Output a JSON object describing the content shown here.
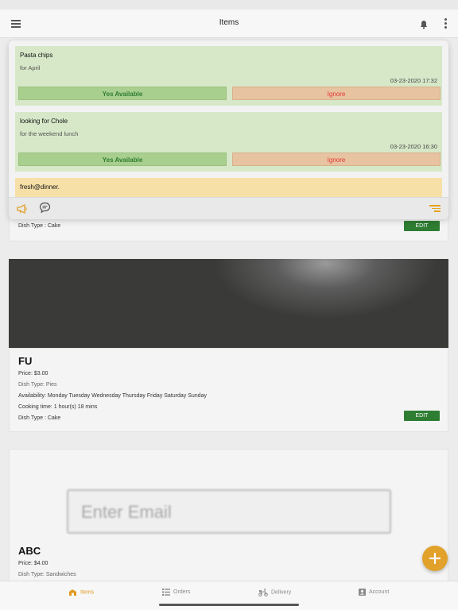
{
  "header": {
    "title": "Items",
    "menu_icon": "hamburger-menu-icon",
    "bell_icon": "bell-icon",
    "more_icon": "kebab-menu-icon"
  },
  "notifications": [
    {
      "title": "Pasta chips",
      "description": "for April",
      "timestamp": "03-23-2020 17:32",
      "yes_label": "Yes Available",
      "ignore_label": "Ignore"
    },
    {
      "title": "looking for Chole",
      "description": "for the weekend lunch",
      "timestamp": "03-23-2020 16:30",
      "yes_label": "Yes Available",
      "ignore_label": "Ignore"
    },
    {
      "title": "fresh@dinner."
    }
  ],
  "popup_footer": {
    "left_icons": [
      "megaphone-icon",
      "chat-bubble-icon"
    ],
    "right_icon": "filter-icon"
  },
  "items": [
    {
      "dish_type_2": "Dish Type : Cake",
      "edit_label": "EDIT"
    },
    {
      "name": "FU",
      "price": "Price: $3.00",
      "dish_type": "Dish Type: Pies",
      "availability": "Availability: Monday Tuesday Wednesday Thursday Friday Saturday Sunday",
      "cooking_time": "Cooking time: 1 hour(s) 18 mins",
      "dish_type_2": "Dish Type : Cake",
      "edit_label": "EDIT"
    },
    {
      "name": "ABC",
      "price": "Price: $4.00",
      "dish_type": "Dish Type: Sandwiches",
      "image_text": "Enter Email"
    }
  ],
  "tabs": [
    {
      "label": "Items",
      "icon": "items-icon",
      "active": true
    },
    {
      "label": "Orders",
      "icon": "list-icon",
      "active": false
    },
    {
      "label": "Delivery",
      "icon": "scooter-icon",
      "active": false
    },
    {
      "label": "Account",
      "icon": "account-icon",
      "active": false
    }
  ],
  "colors": {
    "accent": "#e1a12a",
    "edit_green": "#2e7d32",
    "notif_green": "#d6e8c8",
    "notif_yellow": "#f6e0a8",
    "ignore_red": "#e53935"
  }
}
